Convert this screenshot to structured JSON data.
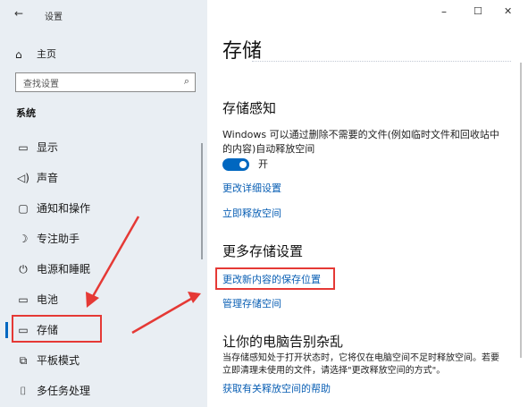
{
  "window": {
    "title": "设置",
    "back_icon": "←",
    "minimize": "–",
    "maximize": "☐",
    "close": "✕"
  },
  "sidebar": {
    "home_label": "主页",
    "search_placeholder": "查找设置",
    "section_label": "系统",
    "items": [
      {
        "label": "显示",
        "icon": "display-icon"
      },
      {
        "label": "声音",
        "icon": "sound-icon"
      },
      {
        "label": "通知和操作",
        "icon": "notification-icon"
      },
      {
        "label": "专注助手",
        "icon": "moon-icon"
      },
      {
        "label": "电源和睡眠",
        "icon": "power-icon"
      },
      {
        "label": "电池",
        "icon": "battery-icon"
      },
      {
        "label": "存储",
        "icon": "storage-icon"
      },
      {
        "label": "平板模式",
        "icon": "tablet-icon"
      },
      {
        "label": "多任务处理",
        "icon": "multitask-icon"
      }
    ]
  },
  "main": {
    "title": "存储",
    "storage_sense": {
      "heading": "存储感知",
      "description": "Windows 可以通过删除不需要的文件(例如临时文件和回收站中的内容)自动释放空间",
      "toggle_label": "开",
      "toggle_on": true,
      "link_change_details": "更改详细设置",
      "link_free_now": "立即释放空间"
    },
    "more_settings": {
      "heading": "更多存储设置",
      "link_save_location": "更改新内容的保存位置",
      "link_manage_spaces": "管理存储空间"
    },
    "declutter": {
      "heading": "让你的电脑告别杂乱",
      "description": "当存储感知处于打开状态时，它将仅在电脑空间不足时释放空间。若要立即清理未使用的文件，请选择\"更改释放空间的方式\"。",
      "link_help": "获取有关释放空间的帮助"
    }
  },
  "colors": {
    "sidebar_bg": "#e9eef3",
    "accent": "#0a5fb4",
    "toggle_on": "#0067c0",
    "annotation_red": "#e53935"
  }
}
